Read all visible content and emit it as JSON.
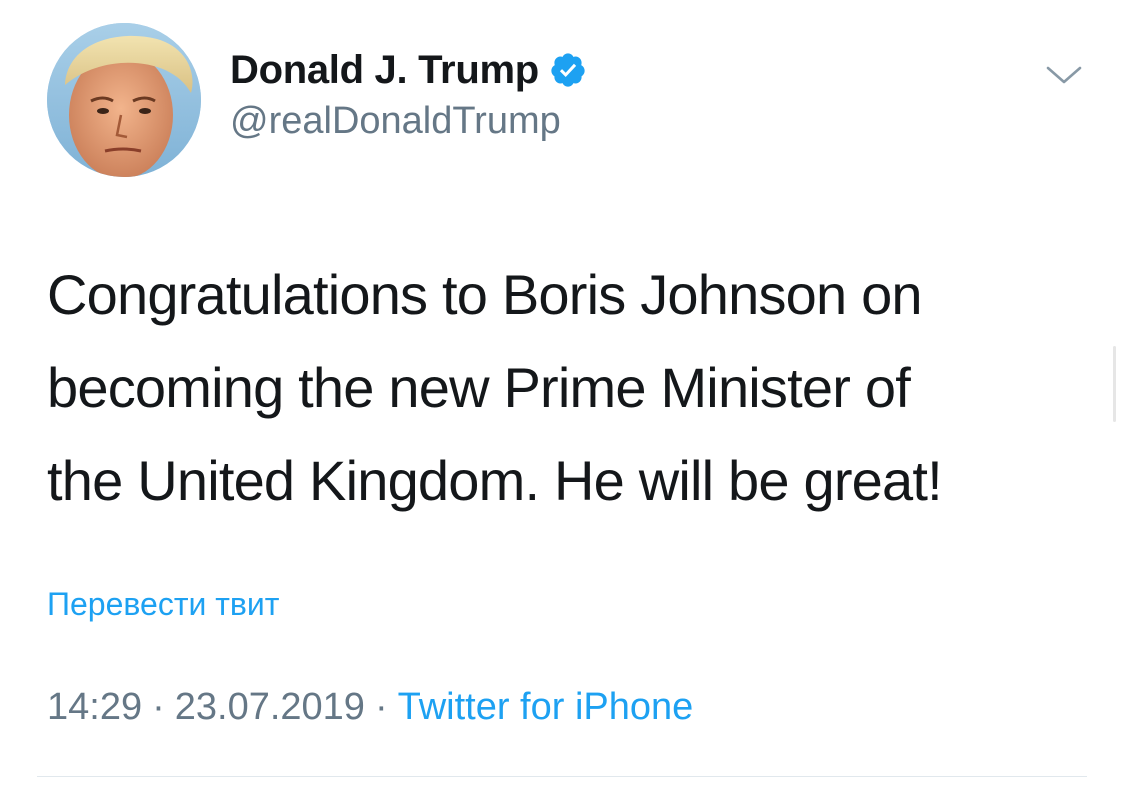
{
  "author": {
    "display_name": "Donald J. Trump",
    "handle": "@realDonaldTrump",
    "verified": true,
    "avatar_icon": "profile-photo",
    "verified_icon": "verified-badge-icon"
  },
  "tweet": {
    "text": "Congratulations to Boris Johnson on becoming the new Prime Minister of the United Kingdom. He will be great!",
    "text_lines": [
      "Congratulations to Boris Johnson on",
      "becoming the new Prime Minister of",
      "the United Kingdom. He will be great!"
    ],
    "translate_label": "Перевести твит",
    "time": "14:29",
    "separator": "·",
    "date": "23.07.2019",
    "source": "Twitter for iPhone",
    "menu_icon": "chevron-down-icon"
  },
  "colors": {
    "accent": "#1da1f2",
    "text": "#14171a",
    "secondary": "#657786",
    "divider": "#e1e8ed"
  }
}
